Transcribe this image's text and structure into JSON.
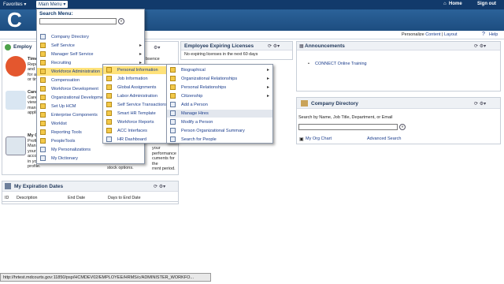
{
  "topbar": {
    "favorites": "Favorites",
    "main_menu": "Main Menu",
    "home": "Home",
    "sign_out": "Sign out"
  },
  "subbar": {
    "personalize": "Personalize",
    "content": "Content",
    "sep": "|",
    "layout": "Layout",
    "help": "Help"
  },
  "search_menu": {
    "label": "Search Menu:",
    "value": ""
  },
  "main_menu_items": [
    {
      "label": "Company Directory"
    },
    {
      "label": "Self Service"
    },
    {
      "label": "Manager Self Service"
    },
    {
      "label": "Recruiting"
    },
    {
      "label": "Workforce Administration"
    },
    {
      "label": "Compensation"
    },
    {
      "label": "Workforce Development"
    },
    {
      "label": "Organizational Development"
    },
    {
      "label": "Set Up HCM"
    },
    {
      "label": "Enterprise Components"
    },
    {
      "label": "Worklist"
    },
    {
      "label": "Reporting Tools"
    },
    {
      "label": "PeopleTools"
    },
    {
      "label": "My Personalizations"
    },
    {
      "label": "My Dictionary"
    }
  ],
  "workforce_admin_items": [
    {
      "label": "Personal Information"
    },
    {
      "label": "Job Information"
    },
    {
      "label": "Global Assignments"
    },
    {
      "label": "Labor Administration"
    },
    {
      "label": "Self Service Transactions"
    },
    {
      "label": "Smart HR Template"
    },
    {
      "label": "Workforce Reports"
    },
    {
      "label": "ACC Interfaces"
    },
    {
      "label": "HR Dashboard"
    }
  ],
  "personal_info_items": [
    {
      "label": "Biographical"
    },
    {
      "label": "Organizational Relationships"
    },
    {
      "label": "Personal Relationships"
    },
    {
      "label": "Citizenship"
    },
    {
      "label": "Add a Person"
    },
    {
      "label": "Manage Hires"
    },
    {
      "label": "Modify a Person"
    },
    {
      "label": "Person Organizational Summary"
    },
    {
      "label": "Search for People"
    }
  ],
  "left_pagelet": {
    "title": "Employ",
    "items": [
      {
        "label": "Time",
        "lines": [
          "Repo",
          "and ta",
          "for a",
          "or tim"
        ]
      },
      {
        "label": "Care",
        "lines": [
          "Care",
          "view a",
          "mana",
          "applic"
        ]
      },
      {
        "label": "My C",
        "lines": [
          "Profi",
          "Mana",
          "your",
          "acco",
          "in you",
          "profile."
        ]
      }
    ],
    "perf_lines": [
      "your performance",
      "cuments for the",
      "rrent period."
    ],
    "stock": "stock options.",
    "absence": "bsence"
  },
  "expiring": {
    "title": "Employee Expiring Licenses",
    "empty": "No expiring licenses in the next 60 days"
  },
  "announcements": {
    "title": "Announcements",
    "items": [
      "CONNECT Online Training"
    ]
  },
  "company_directory": {
    "title": "Company Directory",
    "prompt": "Search by Name, Job Title, Department, or Email",
    "value": "",
    "my_org_chart": "My Org Chart",
    "advanced": "Advanced Search"
  },
  "expiration": {
    "title": "My Expiration Dates",
    "columns": [
      "ID",
      "Description",
      "End Date",
      "Days to End Date"
    ]
  },
  "status_url": "http://hrtest.mdcourts.gov:11850/psp/HCMDEV02/EMPLOYEE/HRMS/c/ADMINISTER_WORKFO..."
}
